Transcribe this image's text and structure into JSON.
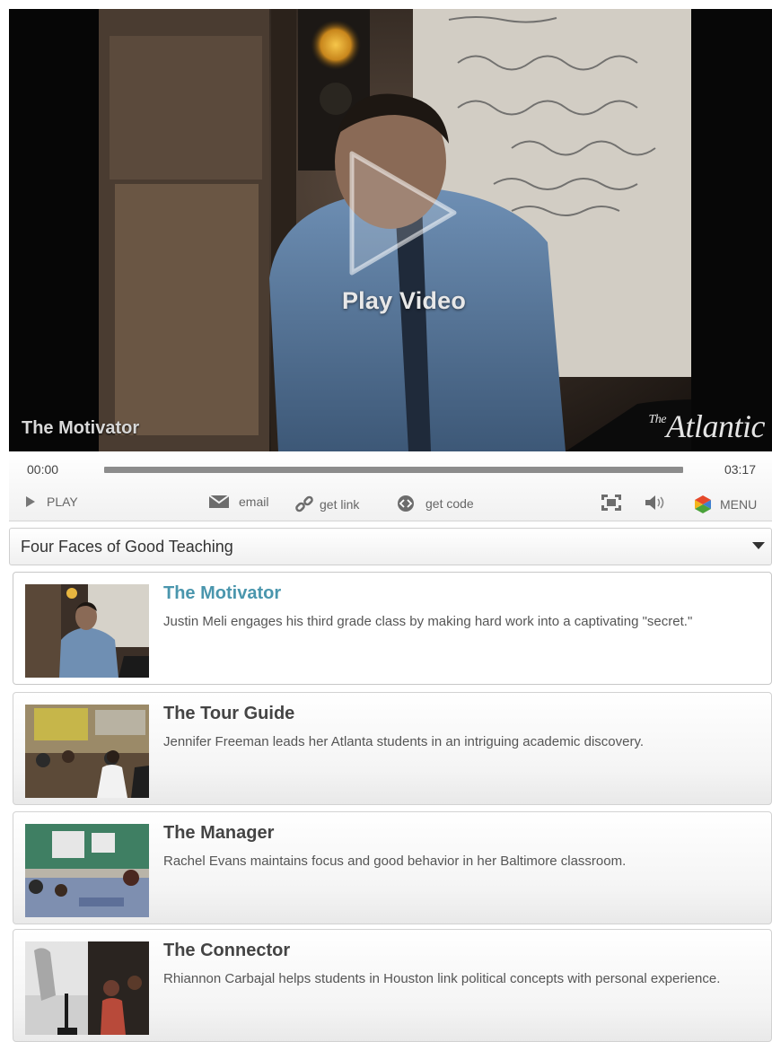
{
  "video": {
    "play_label": "Play Video",
    "title": "The Motivator",
    "brand": "The Atlantic"
  },
  "controls": {
    "time_current": "00:00",
    "time_total": "03:17",
    "progress_fraction": 0.0,
    "play_label": "PLAY",
    "email_label": "email",
    "get_link_label": "get link",
    "get_code_label": "get code",
    "menu_label": "MENU"
  },
  "playlist": {
    "title": "Four Faces of Good Teaching",
    "items": [
      {
        "title": "The Motivator",
        "description": "Justin Meli engages his third grade class by making hard work into a captivating \"secret.\"",
        "active": true
      },
      {
        "title": "The Tour Guide",
        "description": "Jennifer Freeman leads her Atlanta students in an intriguing academic discovery.",
        "active": false
      },
      {
        "title": "The Manager",
        "description": "Rachel Evans maintains focus and good behavior in her Baltimore classroom.",
        "active": false
      },
      {
        "title": "The Connector",
        "description": "Rhiannon Carbajal helps students in Houston link political concepts with personal experience.",
        "active": false
      }
    ]
  },
  "colors": {
    "active_title": "#4a96ad",
    "menu_icon": [
      "#e5492a",
      "#f3b51b",
      "#4aa23a",
      "#3e7fd0"
    ]
  }
}
